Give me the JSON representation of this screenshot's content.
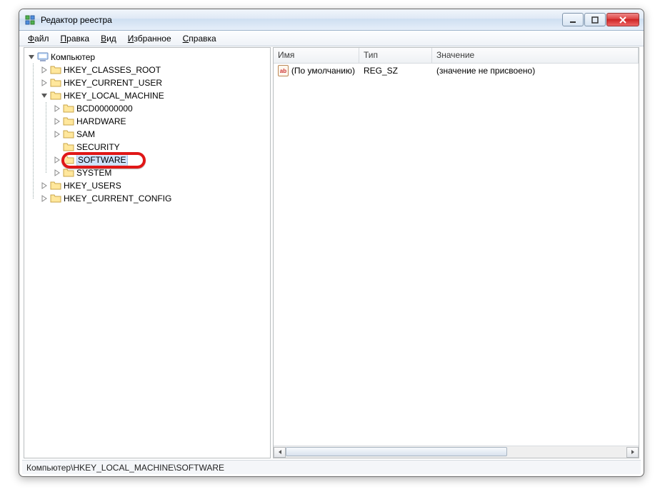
{
  "window": {
    "title": "Редактор реестра"
  },
  "menu": {
    "file": {
      "pre": "",
      "u": "Ф",
      "post": "айл"
    },
    "edit": {
      "pre": "",
      "u": "П",
      "post": "равка"
    },
    "view": {
      "pre": "",
      "u": "В",
      "post": "ид"
    },
    "fav": {
      "pre": "",
      "u": "И",
      "post": "збранное"
    },
    "help": {
      "pre": "",
      "u": "С",
      "post": "правка"
    }
  },
  "tree": {
    "root": "Компьютер",
    "hklm": "HKEY_LOCAL_MACHINE",
    "items": {
      "hkcr": "HKEY_CLASSES_ROOT",
      "hkcu": "HKEY_CURRENT_USER",
      "hku": "HKEY_USERS",
      "hkcc": "HKEY_CURRENT_CONFIG",
      "bcd": "BCD00000000",
      "hw": "HARDWARE",
      "sam": "SAM",
      "sec": "SECURITY",
      "sw": "SOFTWARE",
      "sys": "SYSTEM"
    }
  },
  "list": {
    "headers": {
      "name": "Имя",
      "type": "Тип",
      "value": "Значение"
    },
    "rows": [
      {
        "icon": "ab",
        "name": "(По умолчанию)",
        "type": "REG_SZ",
        "value": "(значение не присвоено)"
      }
    ]
  },
  "statusbar": "Компьютер\\HKEY_LOCAL_MACHINE\\SOFTWARE"
}
